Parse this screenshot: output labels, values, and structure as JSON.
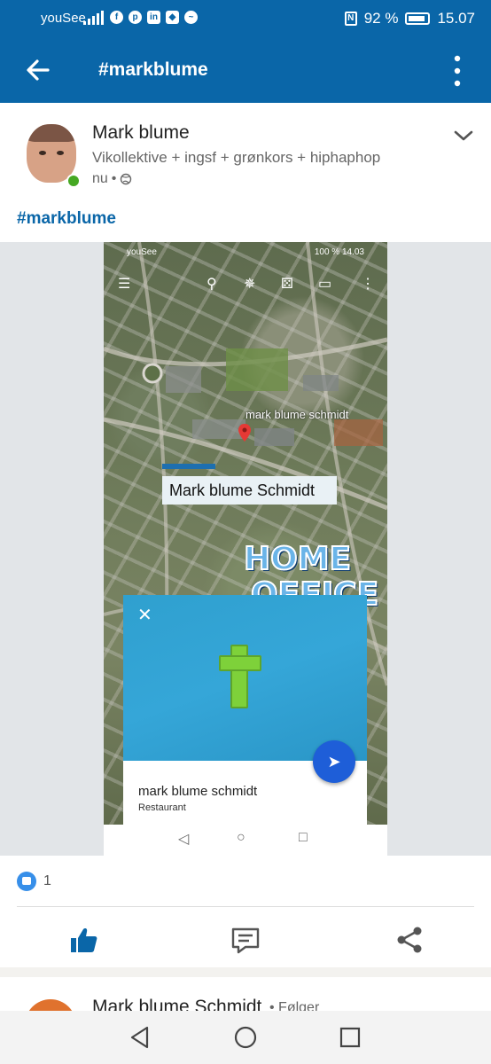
{
  "status_bar": {
    "carrier": "youSee",
    "battery": "92 %",
    "time": "15.07"
  },
  "app_bar": {
    "title": "#markblume"
  },
  "post": {
    "author": "Mark blume",
    "headline": "Vikollektive + ingsf + grønkors + hiphaphop",
    "time": "nu",
    "hashtag": "#markblume",
    "reaction_count": "1"
  },
  "embedded_screenshot": {
    "status_left": "youSee",
    "status_right": "100 % 14.03",
    "pin_label": "mark blume schmidt",
    "map_label": "Mark blume Schmidt",
    "sticker_line1": "HOME",
    "sticker_line2": "OFFICE",
    "place_name": "mark blume schmidt",
    "place_category": "Restaurant"
  },
  "next_post": {
    "author": "Mark blume Schmidt",
    "follow_label": "• Følger"
  },
  "colors": {
    "brand": "#0a66a8",
    "like": "#378fe9",
    "online": "#45a823"
  }
}
